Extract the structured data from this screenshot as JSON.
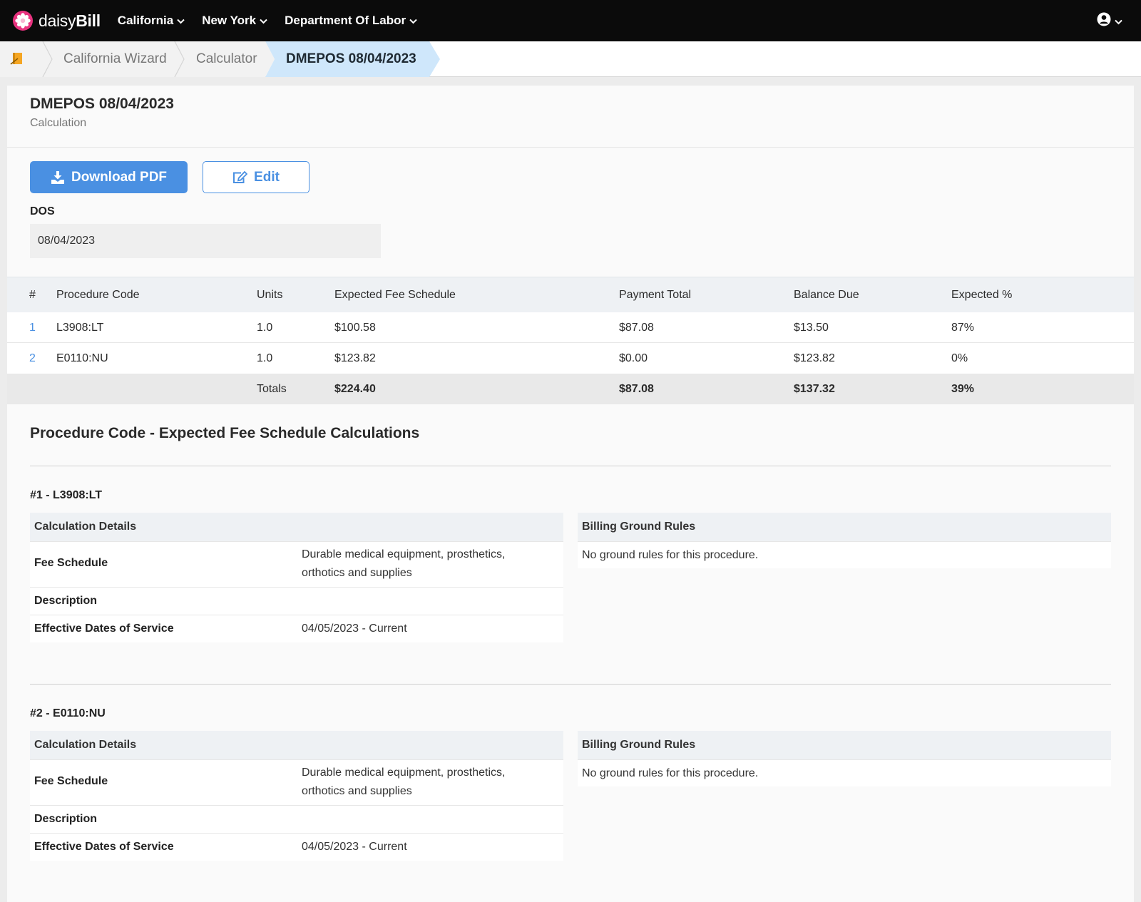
{
  "brand": {
    "prefix": "daisy",
    "suffix": "Bill"
  },
  "nav": {
    "items": [
      {
        "label": "California"
      },
      {
        "label": "New York"
      },
      {
        "label": "Department Of Labor"
      }
    ]
  },
  "breadcrumb": {
    "items": [
      "California Wizard",
      "Calculator",
      "DMEPOS 08/04/2023"
    ]
  },
  "page": {
    "title": "DMEPOS 08/04/2023",
    "subtitle": "Calculation",
    "download_label": "Download PDF",
    "edit_label": "Edit",
    "dos_label": "DOS",
    "dos_value": "08/04/2023"
  },
  "table": {
    "headers": [
      "#",
      "Procedure Code",
      "Units",
      "Expected Fee Schedule",
      "Payment Total",
      "Balance Due",
      "Expected %"
    ],
    "rows": [
      {
        "num": "1",
        "code": "L3908:LT",
        "units": "1.0",
        "expected": "$100.58",
        "payment": "$87.08",
        "balance": "$13.50",
        "pct": "87%"
      },
      {
        "num": "2",
        "code": "E0110:NU",
        "units": "1.0",
        "expected": "$123.82",
        "payment": "$0.00",
        "balance": "$123.82",
        "pct": "0%"
      }
    ],
    "totals": {
      "label": "Totals",
      "expected": "$224.40",
      "payment": "$87.08",
      "balance": "$137.32",
      "pct": "39%"
    }
  },
  "calc_section": {
    "title": "Procedure Code - Expected Fee Schedule Calculations",
    "procedures": [
      {
        "title": "#1 - L3908:LT",
        "details_header": "Calculation Details",
        "fee_schedule_label": "Fee Schedule",
        "fee_schedule_line1": "Durable medical equipment, prosthetics,",
        "fee_schedule_line2": "orthotics and supplies",
        "description_label": "Description",
        "effective_label": "Effective Dates of Service",
        "effective_value": "04/05/2023 - Current",
        "rules_header": "Billing Ground Rules",
        "rules_text": "No ground rules for this procedure."
      },
      {
        "title": "#2 - E0110:NU",
        "details_header": "Calculation Details",
        "fee_schedule_label": "Fee Schedule",
        "fee_schedule_line1": "Durable medical equipment, prosthetics,",
        "fee_schedule_line2": "orthotics and supplies",
        "description_label": "Description",
        "effective_label": "Effective Dates of Service",
        "effective_value": "04/05/2023 - Current",
        "rules_header": "Billing Ground Rules",
        "rules_text": "No ground rules for this procedure."
      }
    ]
  },
  "colors": {
    "topbar": "#0b0b0b",
    "accent": "#4a90e2",
    "active_crumb": "#cfe7fb",
    "logo_pink": "#e8337f"
  }
}
